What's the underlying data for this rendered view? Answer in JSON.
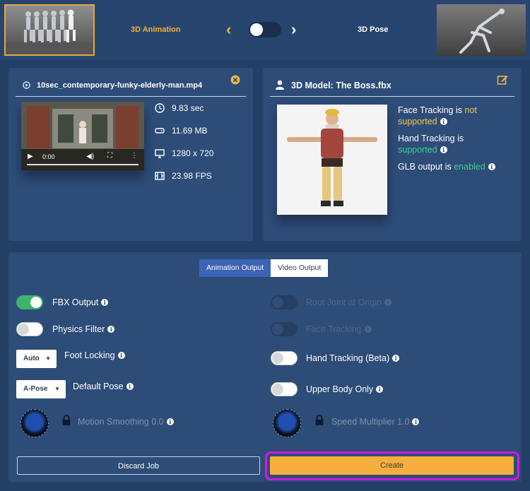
{
  "header": {
    "left_label": "3D Animation",
    "right_label": "3D Pose",
    "chevron_left": "‹",
    "chevron_right": "›",
    "mode_toggle_on": false,
    "accent": "#f4b13c"
  },
  "video_panel": {
    "title": "10sec_contemporary-funky-elderly-man.mp4",
    "player_time": "0:00",
    "stats": [
      {
        "icon": "clock-icon",
        "value": "9.83 sec"
      },
      {
        "icon": "drive-icon",
        "value": "11.69 MB"
      },
      {
        "icon": "monitor-icon",
        "value": "1280 x 720"
      },
      {
        "icon": "film-icon",
        "value": "23.98 FPS"
      }
    ]
  },
  "model_panel": {
    "title": "3D Model:  The Boss.fbx",
    "face_tracking": {
      "prefix": "Face Tracking is ",
      "value1": "not",
      "value2": "supported"
    },
    "hand_tracking": {
      "prefix": "Hand Tracking is",
      "value": "supported"
    },
    "glb_output": {
      "prefix": "GLB output is ",
      "value": "enabled"
    }
  },
  "settings": {
    "tabs": [
      "Animation Output",
      "Video Output"
    ],
    "active_tab": "Animation Output",
    "left_options": {
      "fbx_output": {
        "label": "FBX Output",
        "on": true
      },
      "physics_filter": {
        "label": "Physics Filter",
        "on": false
      },
      "foot_locking": {
        "label": "Foot Locking",
        "selected": "Auto"
      },
      "default_pose": {
        "label": "Default Pose",
        "selected": "A-Pose"
      },
      "motion_smoothing": {
        "label": "Motion Smoothing 0.0"
      }
    },
    "right_options": {
      "root_joint": {
        "label": "Root Joint at Origin",
        "disabled": true
      },
      "face_tracking": {
        "label": "Face Tracking",
        "disabled": true
      },
      "hand_tracking": {
        "label": "Hand Tracking (Beta)",
        "on": false
      },
      "upper_body": {
        "label": "Upper Body Only",
        "on": false
      },
      "speed_multiplier": {
        "label": "Speed Multiplier 1.0"
      }
    },
    "discard_label": "Discard Job",
    "create_label": "Create"
  }
}
